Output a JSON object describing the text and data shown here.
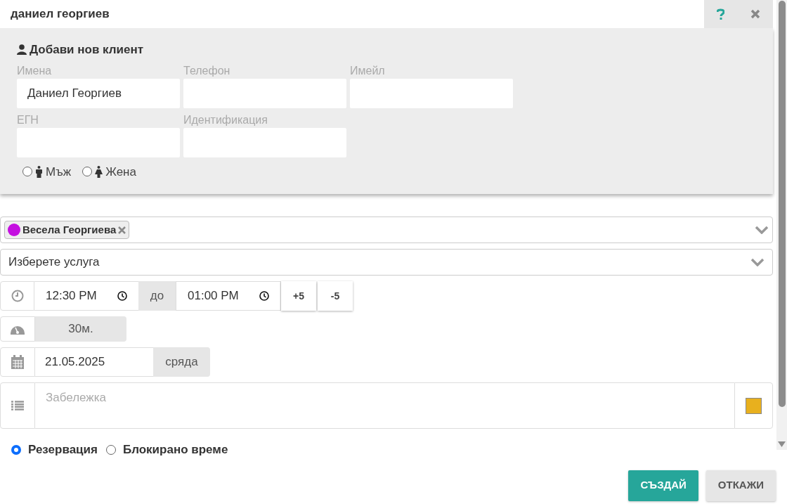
{
  "search": {
    "value": "даниел георгиев"
  },
  "new_client": {
    "title": "Добави нов клиент",
    "fields": [
      {
        "label": "Имена",
        "value": "Даниел Георгиев"
      },
      {
        "label": "Телефон"
      },
      {
        "label": "Имейл"
      },
      {
        "label": "ЕГН"
      },
      {
        "label": "Идентификация"
      }
    ],
    "genders": [
      {
        "kind": "male",
        "label": "Мъж",
        "selected": false
      },
      {
        "kind": "female",
        "label": "Жена",
        "selected": false
      }
    ]
  },
  "staff": {
    "chips": [
      {
        "name": "Весела Георгиева",
        "color": "#c40fe0"
      }
    ]
  },
  "service": {
    "text": "Изберете услуга"
  },
  "time": {
    "start": "12:30 PM",
    "separator": "до",
    "end": "01:00 PM",
    "steps": [
      "+5",
      "-5"
    ]
  },
  "duration": "30м.",
  "date": {
    "value": "21.05.2025",
    "weekday": "сряда"
  },
  "note": {
    "placeholder": "Забележка",
    "color": "#e8b01e"
  },
  "types": [
    {
      "label": "Резервация",
      "selected": true
    },
    {
      "label": "Блокирано време",
      "selected": false
    }
  ],
  "actions": [
    {
      "kind": "primary",
      "label": "СЪЗДАЙ"
    },
    {
      "kind": "secondary",
      "label": "ОТКАЖИ"
    }
  ]
}
